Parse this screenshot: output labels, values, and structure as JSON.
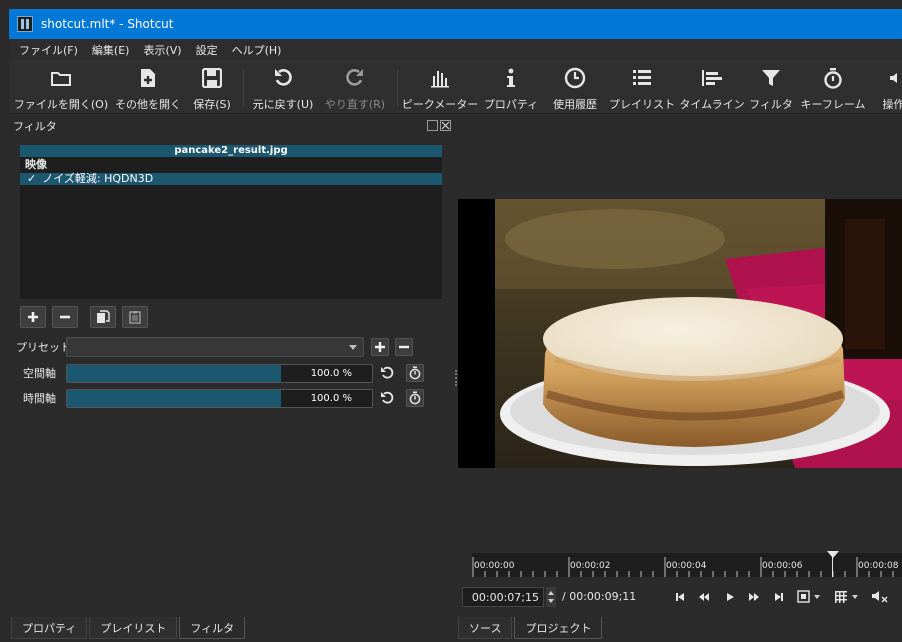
{
  "window": {
    "title": "shotcut.mlt* - Shotcut"
  },
  "menu": [
    "ファイル(F)",
    "編集(E)",
    "表示(V)",
    "設定",
    "ヘルプ(H)"
  ],
  "toolbar": {
    "open": "ファイルを開く(O)",
    "open_other": "その他を開く",
    "save": "保存(S)",
    "undo": "元に戻す(U)",
    "redo": "やり直す(R)",
    "peak_meter": "ピークメーター",
    "properties": "プロパティ",
    "history": "使用履歴",
    "playlist": "プレイリスト",
    "timeline": "タイムライン",
    "filters": "フィルタ",
    "keyframes": "キーフレーム",
    "more": "操作"
  },
  "filters_panel": {
    "title": "フィルタ",
    "clip_name": "pancake2_result.jpg",
    "category": "映像",
    "items": [
      {
        "label": "ノイズ軽減: HQDN3D",
        "checked": true
      }
    ],
    "preset_label": "プリセット",
    "preset_value": "",
    "spatial": {
      "label": "空間軸",
      "value_text": "100.0 %",
      "fraction": 0.7
    },
    "temporal": {
      "label": "時間軸",
      "value_text": "100.0 %",
      "fraction": 0.7
    }
  },
  "left_tabs": [
    "プロパティ",
    "プレイリスト",
    "フィルタ"
  ],
  "right_tabs": [
    "ソース",
    "プロジェクト"
  ],
  "player": {
    "ruler_labels": [
      "00:00:00",
      "00:00:02",
      "00:00:04",
      "00:00:06",
      "00:00:08"
    ],
    "current_time": "00:00:07;15",
    "total_time": "/ 00:00:09;11"
  }
}
